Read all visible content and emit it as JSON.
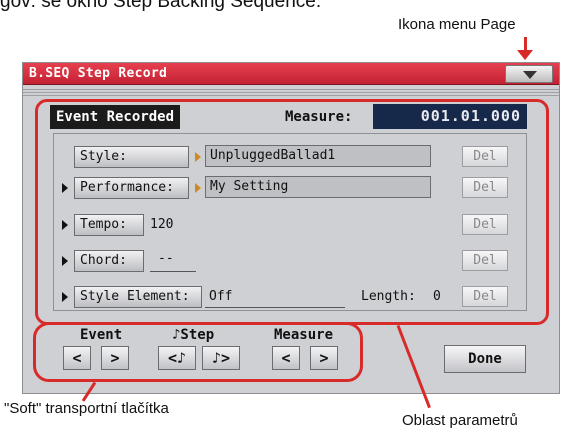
{
  "captions": {
    "top_text": "gov: se okno Step Backing Sequence:",
    "page_menu_icon": "Ikona menu Page",
    "soft_transport": "\"Soft\" transportní tlačítka",
    "parameter_area": "Oblast parametrů"
  },
  "window": {
    "title": "B.SEQ Step Record"
  },
  "header": {
    "event_label": "Event Recorded",
    "measure_label": "Measure:",
    "measure_value": "001.01.000"
  },
  "rows": {
    "style": {
      "label": "Style:",
      "value": "UnpluggedBallad1",
      "del": "Del"
    },
    "performance": {
      "label": "Performance:",
      "value": "My Setting",
      "del": "Del"
    },
    "tempo": {
      "label": "Tempo:",
      "value": "120",
      "del": "Del"
    },
    "chord": {
      "label": "Chord:",
      "value": "--",
      "del": "Del"
    },
    "style_element": {
      "label": "Style Element:",
      "value": "Off",
      "length_label": "Length:",
      "length_value": "0",
      "del": "Del"
    }
  },
  "transport": {
    "event_label": "Event",
    "step_label": "♪Step",
    "measure_label": "Measure",
    "prev": "<",
    "next": ">",
    "step_prev": "<♪",
    "step_next": "♪>",
    "done": "Done"
  },
  "colors": {
    "title_bar": "#d6303f",
    "annotation": "#d92a2a",
    "measure_field": "#17294a"
  }
}
